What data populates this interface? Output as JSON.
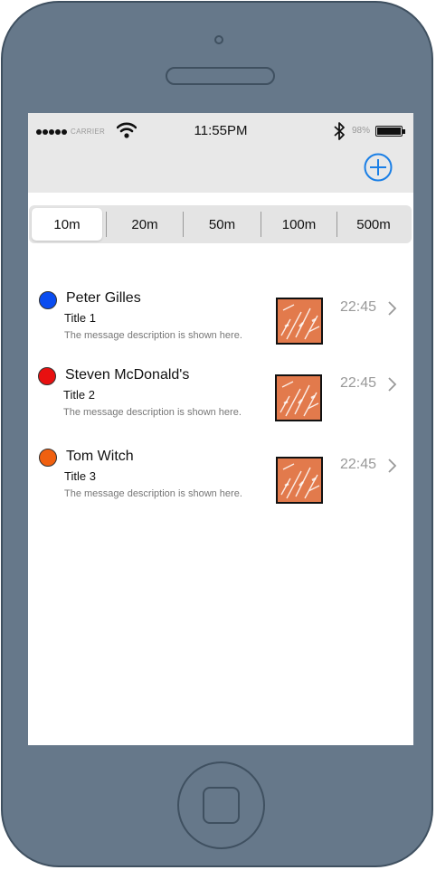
{
  "status_bar": {
    "carrier": "CARRIER",
    "time": "11:55PM",
    "battery": "98%"
  },
  "icons": {
    "signal": "signal-dots-icon",
    "wifi": "wifi-icon",
    "bluetooth": "bluetooth-icon",
    "battery": "battery-icon",
    "add": "plus-circle-icon",
    "chevron": "chevron-right-icon"
  },
  "colors": {
    "accent": "#1a7fe6",
    "topbar_bg": "#e8e8e8",
    "thumb_bg": "#e27a4c"
  },
  "segments": {
    "selected": "10m",
    "items": [
      "10m",
      "20m",
      "50m",
      "100m",
      "500m"
    ]
  },
  "messages": [
    {
      "name": "Peter Gilles",
      "title": "Title 1",
      "description": "The message description is shown here.",
      "time": "22:45",
      "color": "#0a4cf0"
    },
    {
      "name": "Steven McDonald's",
      "title": "Title 2",
      "description": "The message description is shown here.",
      "time": "22:45",
      "color": "#e81010"
    },
    {
      "name": "Tom Witch",
      "title": "Title 3",
      "description": "The message description is shown here.",
      "time": "22:45",
      "color": "#f06010"
    }
  ]
}
